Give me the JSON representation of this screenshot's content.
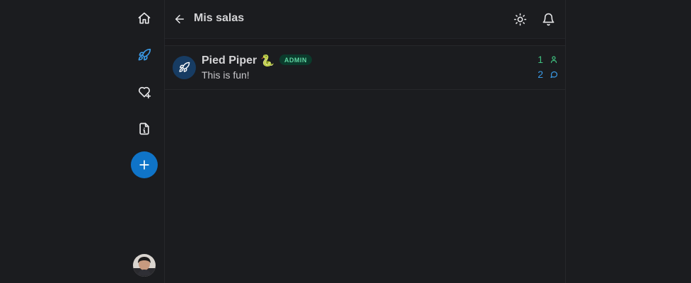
{
  "header": {
    "back_label": "",
    "title": "Mis salas"
  },
  "icons": {
    "home": "home-icon",
    "rooms": "rocket-icon",
    "favorites": "heart-plus-icon",
    "info": "document-info-icon",
    "create": "plus-icon",
    "theme": "sun-icon",
    "notifications": "bell-icon",
    "back": "arrow-left-icon"
  },
  "rooms": [
    {
      "name": "Pied Piper",
      "emoji": "🐍",
      "badge": "ADMIN",
      "subtitle": "This is fun!",
      "members": "1",
      "messages": "2"
    }
  ],
  "colors": {
    "background": "#1b1c1f",
    "accent": "#0f74c8",
    "members": "#3fbf7f",
    "messages": "#3a9ae6",
    "badge_bg": "#0b3b2c",
    "badge_text": "#5fd3a1"
  }
}
